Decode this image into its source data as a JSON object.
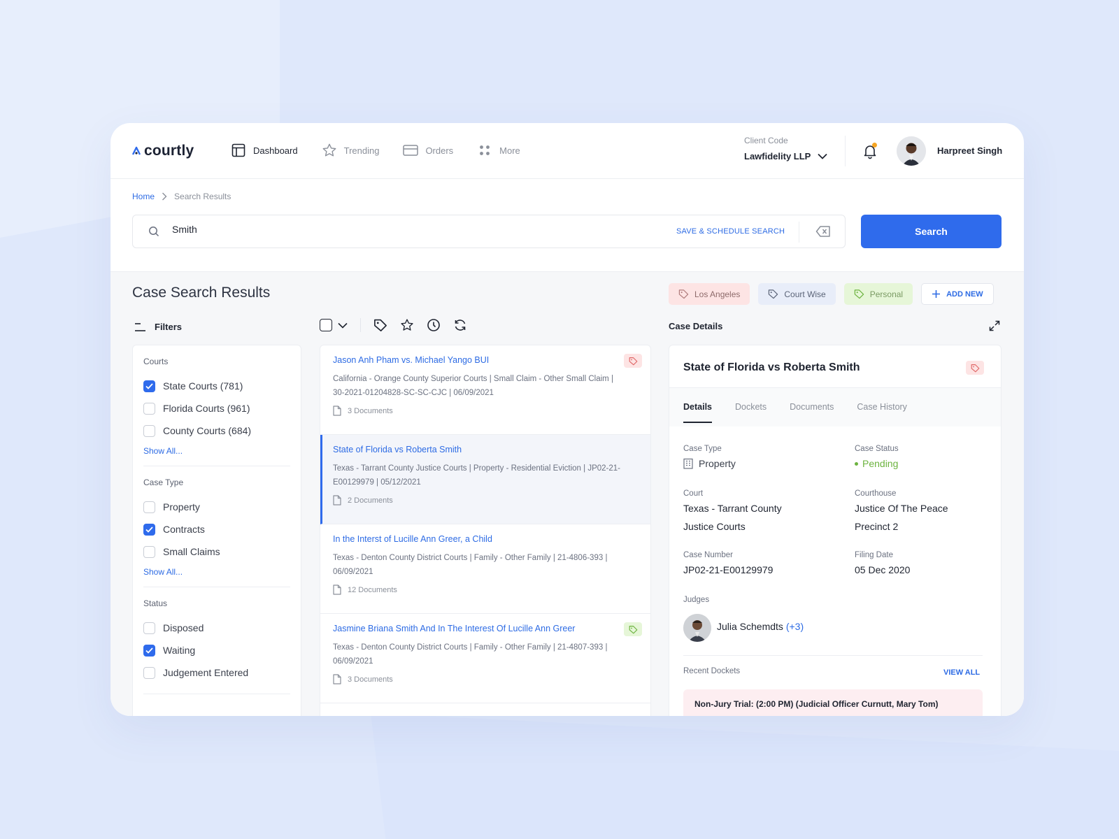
{
  "app": {
    "logo_text": "courtly",
    "brand_color": "#2f6bec"
  },
  "nav": [
    {
      "label": "Dashboard",
      "icon": "dashboard-icon"
    },
    {
      "label": "Trending",
      "icon": "star-icon"
    },
    {
      "label": "Orders",
      "icon": "card-icon"
    },
    {
      "label": "More",
      "icon": "grid-dots-icon"
    }
  ],
  "client": {
    "label": "Client Code",
    "value": "Lawfidelity LLP"
  },
  "user": {
    "name": "Harpreet Singh"
  },
  "breadcrumb": {
    "home": "Home",
    "current": "Search Results"
  },
  "search": {
    "value": "Smith",
    "save_label": "SAVE & SCHEDULE SEARCH",
    "button_label": "Search"
  },
  "page": {
    "title": "Case Search Results"
  },
  "tags": [
    {
      "label": "Los Angeles",
      "color": "#fde4e4"
    },
    {
      "label": "Court Wise",
      "color": "#e8edf9"
    },
    {
      "label": "Personal",
      "color": "#e6f6d8"
    }
  ],
  "add_new_label": "ADD NEW",
  "filters": {
    "title": "Filters",
    "show_all": "Show All...",
    "groups": [
      {
        "title": "Courts",
        "options": [
          {
            "label": "State Courts (781)",
            "checked": true
          },
          {
            "label": "Florida Courts (961)",
            "checked": false
          },
          {
            "label": "County Courts (684)",
            "checked": false
          }
        ]
      },
      {
        "title": "Case Type",
        "options": [
          {
            "label": "Property",
            "checked": false
          },
          {
            "label": "Contracts",
            "checked": true
          },
          {
            "label": "Small Claims",
            "checked": false
          }
        ]
      },
      {
        "title": "Status",
        "options": [
          {
            "label": "Disposed",
            "checked": false
          },
          {
            "label": "Waiting",
            "checked": true
          },
          {
            "label": "Judgement Entered",
            "checked": false
          }
        ]
      }
    ]
  },
  "results": [
    {
      "title": "Jason Anh Pham vs. Michael Yango BUI",
      "desc": "California - Orange County Superior Courts | Small Claim - Other Small Claim | 30-2021-01204828-SC-SC-CJC | 06/09/2021",
      "docs": "3 Documents",
      "tag": "red"
    },
    {
      "title": "State of Florida vs Roberta Smith",
      "desc": "Texas - Tarrant County Justice Courts | Property - Residential Eviction | JP02-21-E00129979 | 05/12/2021",
      "docs": "2 Documents",
      "tag": ""
    },
    {
      "title": "In the Interst of Lucille Ann Greer, a Child",
      "desc": "Texas - Denton County District Courts | Family - Other Family | 21-4806-393 | 06/09/2021",
      "docs": "12 Documents",
      "tag": ""
    },
    {
      "title": "Jasmine Briana Smith And In The Interest Of Lucille Ann Greer",
      "desc": "Texas - Denton County District Courts | Family - Other Family | 21-4807-393 | 06/09/2021",
      "docs": "3 Documents",
      "tag": "green"
    }
  ],
  "case_details": {
    "header": "Case Details",
    "title": "State of Florida vs Roberta Smith",
    "tabs": [
      "Details",
      "Dockets",
      "Documents",
      "Case History"
    ],
    "case_type_label": "Case Type",
    "case_type": "Property",
    "case_status_label": "Case Status",
    "case_status": "Pending",
    "court_label": "Court",
    "court_line1": "Texas - Tarrant County",
    "court_line2": "Justice Courts",
    "courthouse_label": "Courthouse",
    "courthouse_line1": "Justice Of The Peace",
    "courthouse_line2": "Precinct 2",
    "case_number_label": "Case Number",
    "case_number": "JP02-21-E00129979",
    "filing_date_label": "Filing Date",
    "filing_date": "05 Dec 2020",
    "judges_label": "Judges",
    "judge_name": "Julia Schemdts",
    "judge_more": "(+3)",
    "recent_dockets_label": "Recent Dockets",
    "view_all": "VIEW ALL",
    "docket_text": "Non-Jury Trial: (2:00 PM) (Judicial Officer Curnutt, Mary Tom)"
  }
}
